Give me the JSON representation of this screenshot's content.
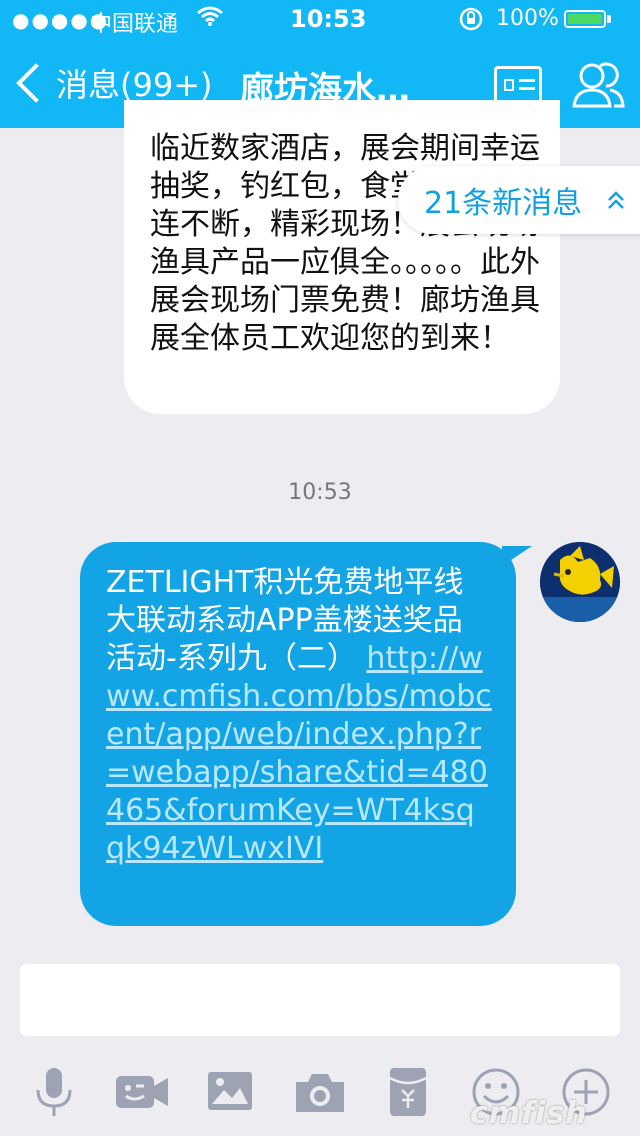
{
  "status_bar": {
    "signal": "●●●●●",
    "carrier": "中国联通",
    "time": "10:53",
    "battery": "100%",
    "battery_color": "#4cd964"
  },
  "nav": {
    "back_label": "消息(99+)",
    "title": "廊坊海水…",
    "card_icon": "profile-card-icon",
    "group_icon": "group-members-icon",
    "color": "#12b7f5"
  },
  "messages": {
    "incoming_text": "临近数家酒店，展会期间幸运抽奖，钓红包，食堂等活动接连不断，精彩现场！展会现场渔具产品一应俱全。。。。。此外展会现场门票免费！廊坊渔具展全体员工欢迎您的到来！",
    "new_messages_label": "21条新消息",
    "timestamp": "10:53",
    "outgoing_text": "ZETLIGHT积光免费地平线大联动系动APP盖楼送奖品活动-系列九（二）",
    "outgoing_link": "http://www.cmfish.com/bbs/mobcent/app/web/index.php?r=webapp/share&tid=480465&forumKey=WT4ksqqk94zWLwxIVI",
    "bubble_color": "#12a4e4"
  },
  "composer": {
    "placeholder": ""
  },
  "toolbar": {
    "icons": [
      "microphone-icon",
      "video-icon",
      "image-icon",
      "camera-icon",
      "red-packet-icon",
      "emoji-icon",
      "plus-icon"
    ]
  },
  "watermark": "cmfish"
}
